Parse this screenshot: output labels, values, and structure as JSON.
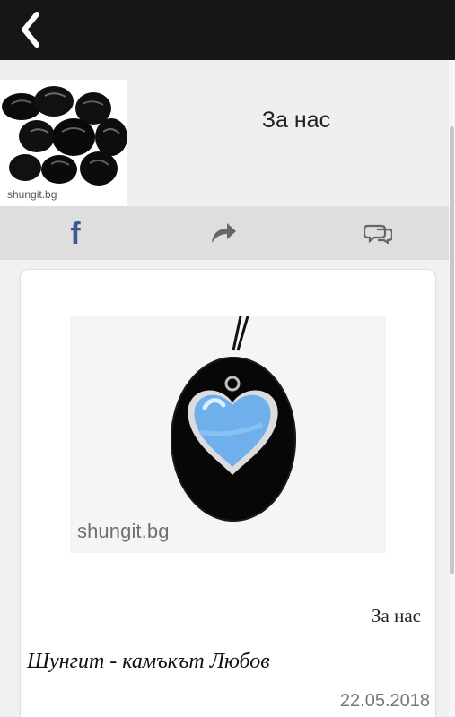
{
  "header": {
    "title": "За нас",
    "thumbnail_caption": "shungit.bg"
  },
  "share_bar": {
    "facebook_glyph": "f",
    "share_icon": "share-icon",
    "comments_icon": "comments-icon"
  },
  "article": {
    "image_watermark": "shungit.bg",
    "category": "За нас",
    "title": "Шунгит - камъкът Любов",
    "date": "22.05.2018"
  },
  "icons": {
    "back": "chevron-left-icon",
    "share": "share-icon",
    "comments": "comments-icon"
  },
  "colors": {
    "topbar": "#161616",
    "facebook": "#3b5998",
    "share_icon": "#666666",
    "pendant": "#6fb0ec"
  }
}
